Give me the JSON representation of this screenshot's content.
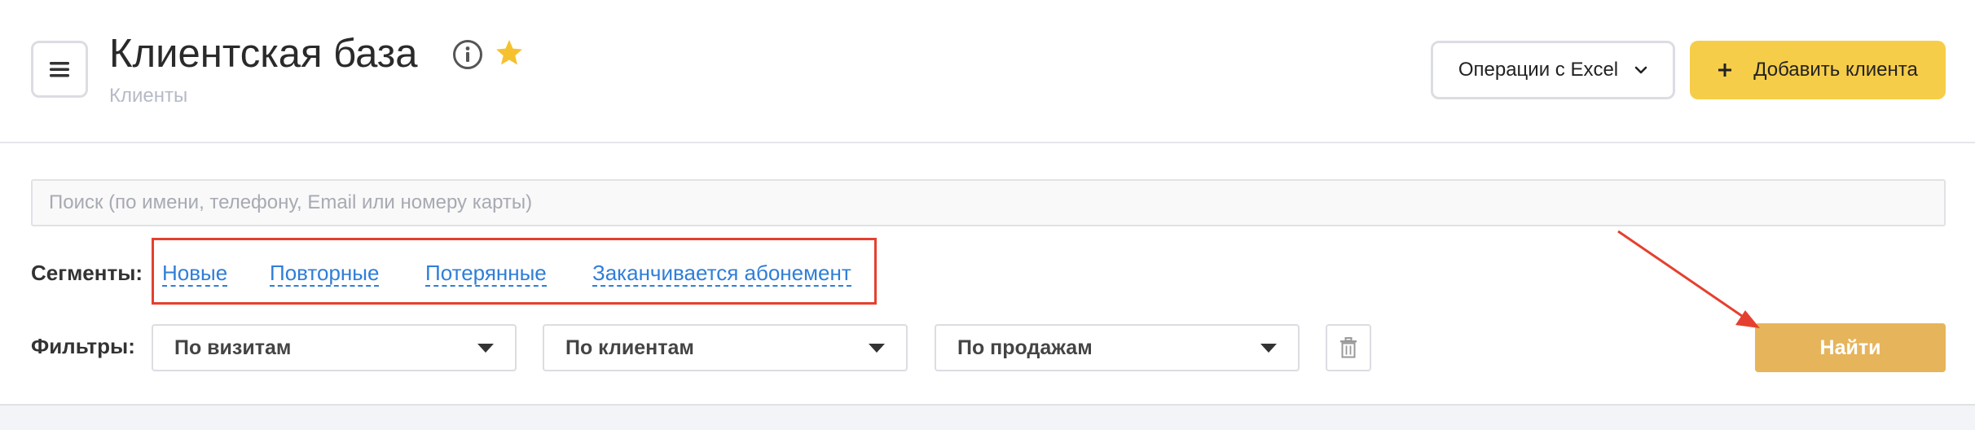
{
  "header": {
    "title": "Клиентская база",
    "subtitle": "Клиенты",
    "menu_icon": "hamburger-icon",
    "info_icon": "info-icon",
    "favorite_icon": "star-icon",
    "favorite_color": "#f6c12f",
    "excel_button": "Операции с Excel",
    "add_button": "Добавить клиента",
    "add_button_color": "#f6cd48"
  },
  "search": {
    "placeholder": "Поиск (по имени, телефону, Email или номеру карты)",
    "value": ""
  },
  "segments": {
    "label": "Сегменты:",
    "items": [
      "Новые",
      "Повторные",
      "Потерянные",
      "Заканчивается абонемент"
    ],
    "link_color": "#2f7ed8",
    "highlight_color": "#e5402f"
  },
  "filters": {
    "label": "Фильтры:",
    "selects": [
      "По визитам",
      "По клиентам",
      "По продажам"
    ],
    "clear_icon": "trash-icon",
    "find_button": "Найти",
    "find_button_color": "#e6b45a"
  }
}
